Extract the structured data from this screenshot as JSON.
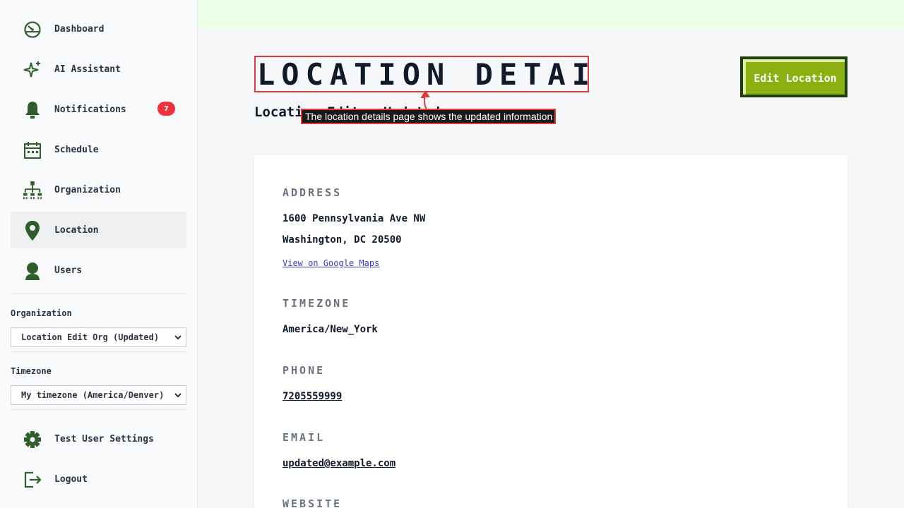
{
  "sidebar": {
    "items": [
      {
        "label": "Dashboard",
        "icon": "dashboard-icon"
      },
      {
        "label": "AI Assistant",
        "icon": "sparkle-icon"
      },
      {
        "label": "Notifications",
        "icon": "bell-icon",
        "badge": "7"
      },
      {
        "label": "Schedule",
        "icon": "calendar-icon"
      },
      {
        "label": "Organization",
        "icon": "org-chart-icon"
      },
      {
        "label": "Location",
        "icon": "location-pin-icon",
        "active": true
      },
      {
        "label": "Users",
        "icon": "user-icon"
      }
    ],
    "organization_label": "Organization",
    "organization_value": "Location Edit Org (Updated)",
    "timezone_label": "Timezone",
    "timezone_value": "My timezone (America/Denver)",
    "footer_items": [
      {
        "label": "Test User Settings",
        "icon": "gear-icon"
      },
      {
        "label": "Logout",
        "icon": "logout-icon"
      }
    ]
  },
  "header": {
    "title": "LOCATION DETAILS",
    "subtitle": "Location Edit - Updated",
    "edit_button": "Edit Location",
    "tooltip": "The location details page shows the updated information"
  },
  "details": {
    "address_heading": "ADDRESS",
    "address_line1": "1600 Pennsylvania Ave NW",
    "address_line2": "Washington, DC 20500",
    "maps_link": "View on Google Maps",
    "timezone_heading": "TIMEZONE",
    "timezone_value": "America/New_York",
    "phone_heading": "PHONE",
    "phone_value": "7205559999",
    "email_heading": "EMAIL",
    "email_value": "updated@example.com",
    "website_heading": "WEBSITE"
  },
  "colors": {
    "accent_green": "#2f5e2a",
    "button_green": "#8caf10",
    "badge_red": "#f0323f",
    "annotation_red": "#e03a3a",
    "topbar": "#eaffe6"
  }
}
